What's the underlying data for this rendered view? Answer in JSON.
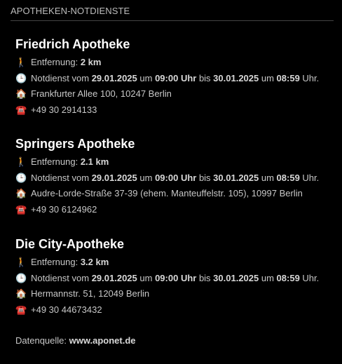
{
  "header": {
    "title": "APOTHEKEN-NOTDIENSTE"
  },
  "labels": {
    "distance_prefix": "Entfernung: ",
    "duty_prefix": "Notdienst vom ",
    "um": " um ",
    "bis": " bis ",
    "uhr_end": " Uhr."
  },
  "icons": {
    "distance": "🚶",
    "duty": "🕒",
    "address": "🏠",
    "phone": "☎️"
  },
  "pharmacies": [
    {
      "name": "Friedrich Apotheke",
      "distance": "2 km",
      "duty_from_date": "29.01.2025",
      "duty_from_time": "09:00 Uhr",
      "duty_to_date": "30.01.2025",
      "duty_to_time": "08:59",
      "address": "Frankfurter Allee 100, 10247 Berlin",
      "phone": "+49 30 2914133"
    },
    {
      "name": "Springers Apotheke",
      "distance": "2.1 km",
      "duty_from_date": "29.01.2025",
      "duty_from_time": "09:00 Uhr",
      "duty_to_date": "30.01.2025",
      "duty_to_time": "08:59",
      "address": "Audre-Lorde-Straße 37-39 (ehem. Manteuffelstr. 105), 10997 Berlin",
      "phone": "+49 30 6124962"
    },
    {
      "name": "Die City-Apotheke",
      "distance": "3.2 km",
      "duty_from_date": "29.01.2025",
      "duty_from_time": "09:00 Uhr",
      "duty_to_date": "30.01.2025",
      "duty_to_time": "08:59",
      "address": "Hermannstr. 51, 12049 Berlin",
      "phone": "+49 30 44673432"
    }
  ],
  "footer": {
    "source_label": "Datenquelle: ",
    "source_link": "www.aponet.de"
  },
  "colors": {
    "background": "#000000",
    "title": "#ffffff",
    "text": "#c8c8c8",
    "divider": "#444444"
  }
}
